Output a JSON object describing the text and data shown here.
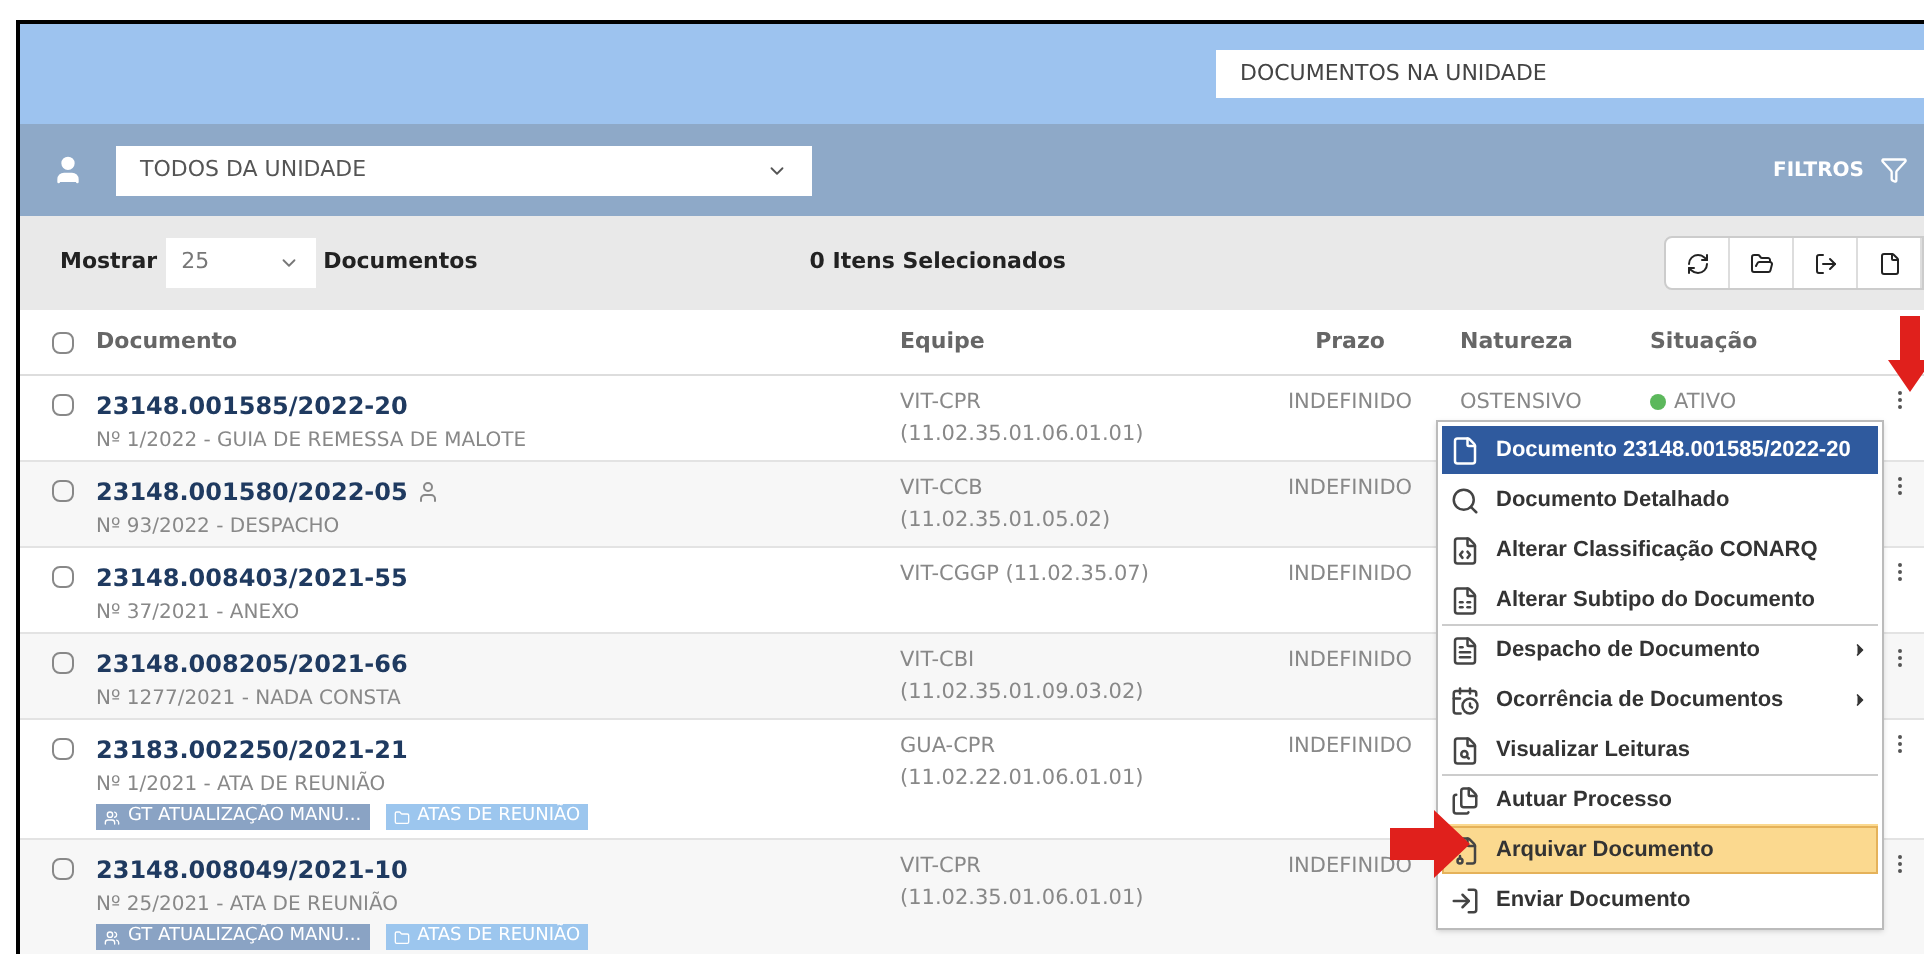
{
  "search": {
    "value": "DOCUMENTOS NA UNIDADE"
  },
  "filter_bar": {
    "select": "TODOS DA UNIDADE",
    "filters_label": "FILTROS"
  },
  "toolbar": {
    "show_label": "Mostrar",
    "page_size": "25",
    "documents_label": "Documentos",
    "selected_count": "0 Itens Selecionados"
  },
  "table": {
    "all_checked": false,
    "columns": [
      "Documento",
      "Equipe",
      "Prazo",
      "Natureza",
      "Situação"
    ],
    "rows": [
      {
        "number": "23148.001585/2022-20",
        "subtitle": "Nº 1/2022 - GUIA DE REMESSA DE MALOTE",
        "user_icon": false,
        "team": "VIT-CPR",
        "team_code": "(11.02.35.01.06.01.01)",
        "deadline": "INDEFINIDO",
        "nature": "OSTENSIVO",
        "status": "ATIVO",
        "color": "#5cb85c",
        "checked": false,
        "tags": []
      },
      {
        "number": "23148.001580/2022-05",
        "subtitle": "Nº 93/2022 - DESPACHO",
        "user_icon": true,
        "team": "VIT-CCB",
        "team_code": "(11.02.35.01.05.02)",
        "deadline": "INDEFINIDO",
        "checked": false,
        "tags": []
      },
      {
        "number": "23148.008403/2021-55",
        "subtitle": "Nº 37/2021 - ANEXO",
        "user_icon": false,
        "team": "VIT-CGGP (11.02.35.07)",
        "deadline": "INDEFINIDO",
        "checked": false,
        "tags": []
      },
      {
        "number": "23148.008205/2021-66",
        "subtitle": "Nº 1277/2021 - NADA CONSTA",
        "user_icon": false,
        "team": "VIT-CBI",
        "team_code": "(11.02.35.01.09.03.02)",
        "deadline": "INDEFINIDO",
        "checked": false,
        "tags": []
      },
      {
        "number": "23183.002250/2021-21",
        "subtitle": "Nº 1/2021 - ATA DE REUNIÃO",
        "user_icon": false,
        "team": "GUA-CPR",
        "team_code": "(11.02.22.01.06.01.01)",
        "deadline": "INDEFINIDO",
        "checked": false,
        "tags": [
          {
            "kind": "group",
            "label": "GT ATUALIZAÇÃO MANU...",
            "color": "#8aa3c4"
          },
          {
            "kind": "folder",
            "label": "ATAS DE REUNIÃO",
            "color": "#9cc6ee"
          }
        ]
      },
      {
        "number": "23148.008049/2021-10",
        "subtitle": "Nº 25/2021 - ATA DE REUNIÃO",
        "user_icon": false,
        "team": "VIT-CPR",
        "team_code": "(11.02.35.01.06.01.01)",
        "deadline": "INDEFINIDO",
        "checked": false,
        "tags": [
          {
            "kind": "group",
            "label": "GT ATUALIZAÇÃO MANU...",
            "color": "#8aa3c4"
          },
          {
            "kind": "folder",
            "label": "ATAS DE REUNIÃO",
            "color": "#9cc6ee"
          }
        ]
      }
    ]
  },
  "context_menu": {
    "title": "Documento 23148.001585/2022-20",
    "items": [
      {
        "kind": "search",
        "label": "Documento Detalhado",
        "highlighted": false,
        "submenu": false,
        "divider_before": false
      },
      {
        "kind": "classify",
        "label": "Alterar Classificação CONARQ",
        "highlighted": false,
        "submenu": false,
        "divider_before": false
      },
      {
        "kind": "subtype",
        "label": "Alterar Subtipo do Documento",
        "highlighted": false,
        "submenu": false,
        "divider_before": false
      },
      {
        "kind": "dispatch",
        "label": "Despacho de Documento",
        "highlighted": false,
        "submenu": true,
        "divider_before": true
      },
      {
        "kind": "calendar",
        "label": "Ocorrência de Documentos",
        "highlighted": false,
        "submenu": true,
        "divider_before": false
      },
      {
        "kind": "view",
        "label": "Visualizar Leituras",
        "highlighted": false,
        "submenu": false,
        "divider_before": false
      },
      {
        "kind": "files",
        "label": "Autuar Processo",
        "highlighted": false,
        "submenu": false,
        "divider_before": true
      },
      {
        "kind": "archive",
        "label": "Arquivar Documento",
        "highlighted": true,
        "submenu": false,
        "divider_before": false
      },
      {
        "kind": "send",
        "label": "Enviar Documento",
        "highlighted": false,
        "submenu": false,
        "divider_before": false
      }
    ]
  }
}
